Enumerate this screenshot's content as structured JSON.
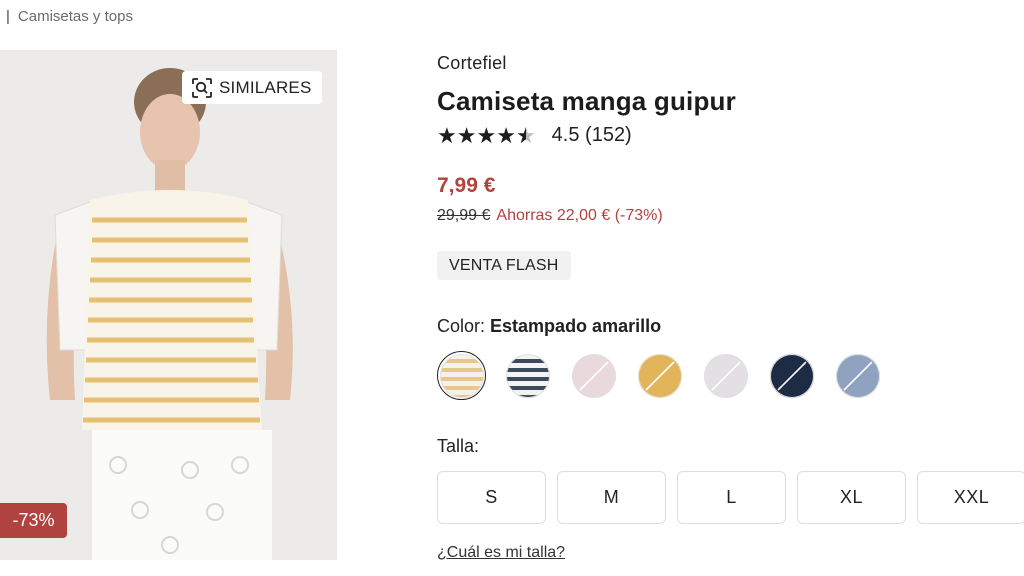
{
  "breadcrumb": {
    "separator": "|",
    "current": "Camisetas y tops"
  },
  "image": {
    "similar_label": "SIMILARES",
    "discount_tag": "-73%"
  },
  "product": {
    "brand": "Cortefiel",
    "title": "Camiseta manga guipur",
    "rating_value": 4.5,
    "rating_text": "4.5 (152)",
    "price": "7,99 €",
    "old_price": "29,99 €",
    "savings": "Ahorras 22,00 € (-73%)",
    "badge": "VENTA FLASH"
  },
  "color": {
    "label": "Color:",
    "selected": "Estampado amarillo",
    "swatches": [
      {
        "name": "stripe-yellow-swatch",
        "colors": [
          "#e8c78a",
          "#f6f2ea"
        ],
        "selected": true,
        "unavailable": false
      },
      {
        "name": "stripe-navy-swatch",
        "colors": [
          "#3d4a5c",
          "#f3f3f3"
        ],
        "selected": false,
        "unavailable": false
      },
      {
        "name": "pink-swatch",
        "colors": [
          "#e9d9dc"
        ],
        "selected": false,
        "unavailable": true
      },
      {
        "name": "yellow-swatch",
        "colors": [
          "#e2b55a"
        ],
        "selected": false,
        "unavailable": true
      },
      {
        "name": "light-grey-swatch",
        "colors": [
          "#e4dfe3"
        ],
        "selected": false,
        "unavailable": true
      },
      {
        "name": "navy-swatch",
        "colors": [
          "#1d2b44"
        ],
        "selected": false,
        "unavailable": true
      },
      {
        "name": "light-blue-swatch",
        "colors": [
          "#8fa3c0"
        ],
        "selected": false,
        "unavailable": true
      }
    ]
  },
  "sizes": {
    "label": "Talla:",
    "options": [
      "S",
      "M",
      "L",
      "XL",
      "XXL"
    ],
    "guide": "¿Cuál es mi talla?"
  },
  "colors": {
    "accent": "#b0423f",
    "text": "#222222"
  }
}
